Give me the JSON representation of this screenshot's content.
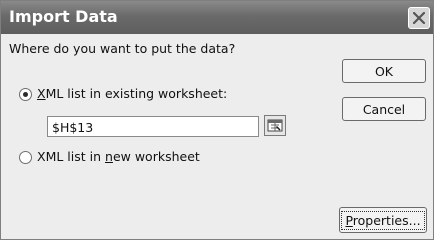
{
  "dialog": {
    "title": "Import Data",
    "question": "Where do you want to put the data?",
    "options": [
      {
        "prefix": "",
        "accel": "X",
        "rest": "ML list in existing worksheet:",
        "selected": true
      },
      {
        "prefix": "XML list in ",
        "accel": "n",
        "rest": "ew worksheet",
        "selected": false
      }
    ],
    "range_value": "$H$13",
    "buttons": {
      "ok": "OK",
      "cancel": "Cancel",
      "properties": {
        "accel": "P",
        "rest": "roperties..."
      }
    }
  },
  "icons": {
    "close": "close-icon",
    "range_picker": "range-collapse-icon"
  }
}
